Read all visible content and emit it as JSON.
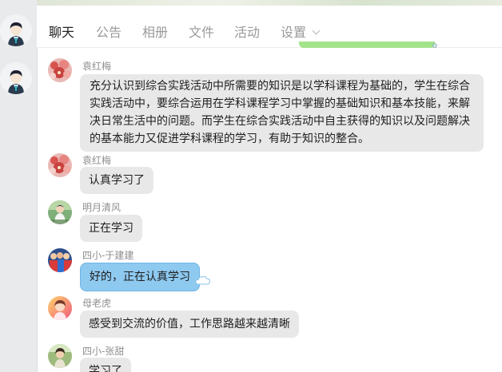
{
  "tabs": {
    "chat": "聊天",
    "notice": "公告",
    "album": "相册",
    "file": "文件",
    "activity": "活动",
    "settings": "设置"
  },
  "active_tab": "chat",
  "messages": [
    {
      "sender": "袁红梅",
      "text": "充分认识到综合实践活动中所需要的知识是以学科课程为基础的，学生在综合实践活动中，要综合运用在学科课程学习中掌握的基础知识和基本技能，来解决日常生活中的问题。而学生在综合实践活动中自主获得的知识以及问题解决的基本能力又促进学科课程的学习，有助于知识的整合。"
    },
    {
      "sender": "袁红梅",
      "text": "认真学习了"
    },
    {
      "sender": "明月清风",
      "text": "正在学习"
    },
    {
      "sender": "四小-于建建",
      "text": "好的，正在认真学习"
    },
    {
      "sender": "母老虎",
      "text": "感受到交流的价值，工作思路越来越清晰"
    },
    {
      "sender": "四小-张甜",
      "text": "学习了"
    }
  ],
  "colors": {
    "bubble_default": "#e8e8e8",
    "bubble_highlight": "#8ec9f0",
    "rail_bg": "#e9eaec",
    "active_tab": "#222222",
    "inactive_tab": "#9a9a9a"
  }
}
